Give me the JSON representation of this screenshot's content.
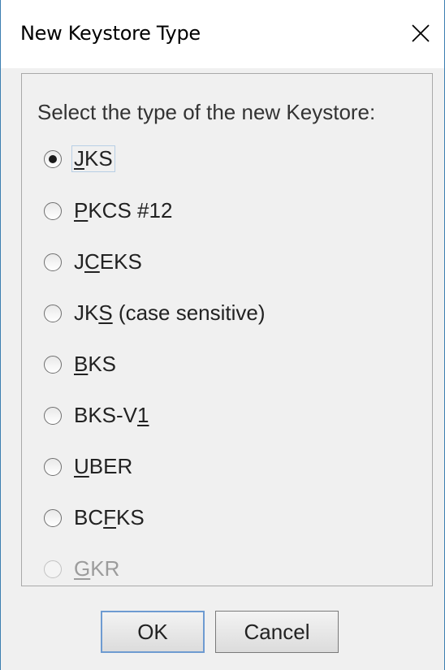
{
  "window": {
    "title": "New Keystore Type",
    "close_icon": "close-icon"
  },
  "prompt": "Select the type of the new Keystore:",
  "options": [
    {
      "before": "",
      "mnemonic": "J",
      "after": "KS",
      "checked": true,
      "enabled": true
    },
    {
      "before": "",
      "mnemonic": "P",
      "after": "KCS #12",
      "checked": false,
      "enabled": true
    },
    {
      "before": "J",
      "mnemonic": "C",
      "after": "EKS",
      "checked": false,
      "enabled": true
    },
    {
      "before": "JK",
      "mnemonic": "S",
      "after": " (case sensitive)",
      "checked": false,
      "enabled": true
    },
    {
      "before": "",
      "mnemonic": "B",
      "after": "KS",
      "checked": false,
      "enabled": true
    },
    {
      "before": "BKS-V",
      "mnemonic": "1",
      "after": "",
      "checked": false,
      "enabled": true
    },
    {
      "before": "",
      "mnemonic": "U",
      "after": "BER",
      "checked": false,
      "enabled": true
    },
    {
      "before": "BC",
      "mnemonic": "F",
      "after": "KS",
      "checked": false,
      "enabled": true
    },
    {
      "before": "",
      "mnemonic": "G",
      "after": "KR",
      "checked": false,
      "enabled": false
    }
  ],
  "buttons": {
    "ok_label": "OK",
    "cancel_label": "Cancel"
  }
}
